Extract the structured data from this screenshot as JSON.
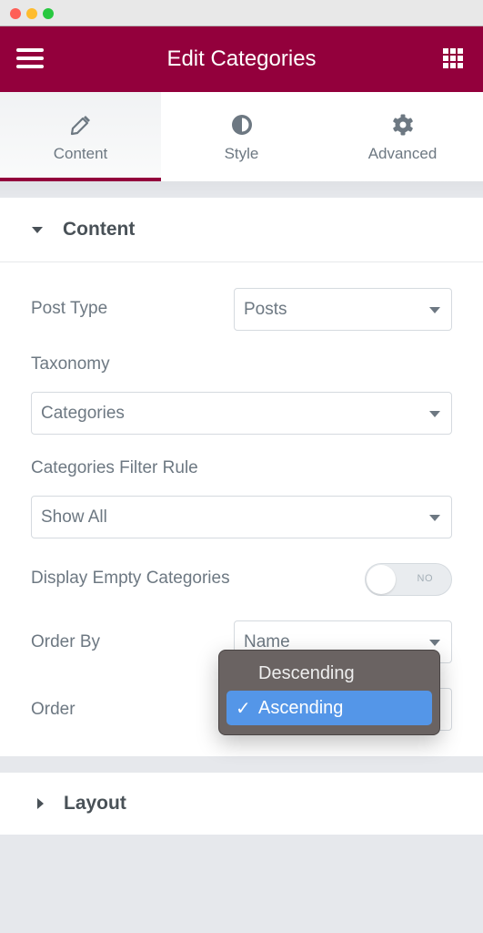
{
  "window": {
    "traffic_lights": [
      "close",
      "minimize",
      "maximize"
    ]
  },
  "header": {
    "title": "Edit Categories",
    "menu_icon": "hamburger-icon",
    "apps_icon": "grid-icon",
    "brand_color": "#93003c"
  },
  "tabs": [
    {
      "label": "Content",
      "icon": "pencil-icon",
      "active": true
    },
    {
      "label": "Style",
      "icon": "half-circle-icon",
      "active": false
    },
    {
      "label": "Advanced",
      "icon": "gear-icon",
      "active": false
    }
  ],
  "content_section": {
    "title": "Content",
    "expanded": true,
    "controls": {
      "post_type": {
        "label": "Post Type",
        "value": "Posts"
      },
      "taxonomy": {
        "label": "Taxonomy",
        "value": "Categories"
      },
      "filter_rule": {
        "label": "Categories Filter Rule",
        "value": "Show All"
      },
      "display_empty": {
        "label": "Display Empty Categories",
        "toggle_text": "NO",
        "value": false
      },
      "order_by": {
        "label": "Order By",
        "value": "Name"
      },
      "order": {
        "label": "Order",
        "value": "Ascending"
      }
    }
  },
  "order_dropdown": {
    "options": [
      {
        "label": "Descending",
        "selected": false
      },
      {
        "label": "Ascending",
        "selected": true
      }
    ],
    "check_glyph": "✓",
    "highlight_color": "#5496e8"
  },
  "layout_section": {
    "title": "Layout",
    "expanded": false
  }
}
